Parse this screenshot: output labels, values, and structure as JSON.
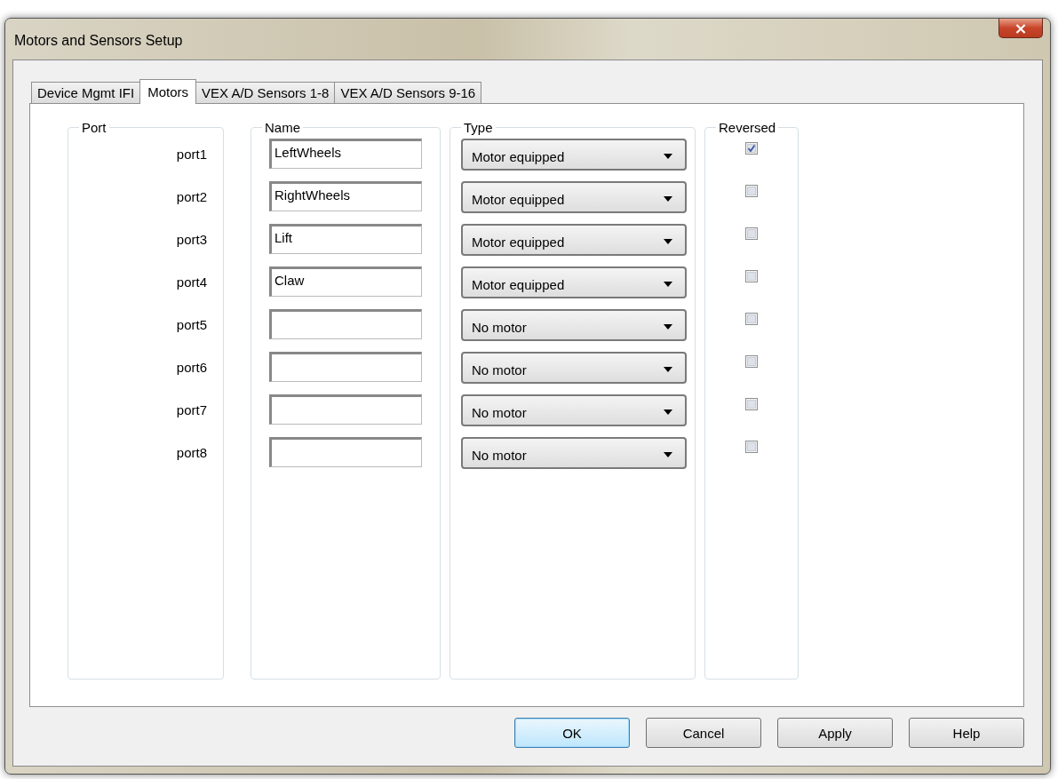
{
  "window": {
    "title": "Motors and Sensors Setup",
    "close": "×"
  },
  "tabs": [
    {
      "label": "Device Mgmt IFI",
      "selected": false
    },
    {
      "label": "Motors",
      "selected": true
    },
    {
      "label": "VEX A/D Sensors 1-8",
      "selected": false
    },
    {
      "label": "VEX A/D Sensors 9-16",
      "selected": false
    }
  ],
  "groups": {
    "port": "Port",
    "name": "Name",
    "type": "Type",
    "reversed": "Reversed"
  },
  "motors": [
    {
      "port": "port1",
      "name": "LeftWheels",
      "type": "Motor equipped",
      "reversed": true
    },
    {
      "port": "port2",
      "name": "RightWheels",
      "type": "Motor equipped",
      "reversed": false
    },
    {
      "port": "port3",
      "name": "Lift",
      "type": "Motor equipped",
      "reversed": false
    },
    {
      "port": "port4",
      "name": "Claw",
      "type": "Motor equipped",
      "reversed": false
    },
    {
      "port": "port5",
      "type": "No motor",
      "reversed": false
    },
    {
      "port": "port6",
      "type": "No motor",
      "reversed": false
    },
    {
      "port": "port7",
      "type": "No motor",
      "reversed": false
    },
    {
      "port": "port8",
      "type": "No motor",
      "reversed": false
    }
  ],
  "buttons": [
    {
      "label": "OK",
      "default": true
    },
    {
      "label": "Cancel",
      "default": false
    },
    {
      "label": "Apply",
      "default": false
    },
    {
      "label": "Help",
      "default": false
    }
  ]
}
